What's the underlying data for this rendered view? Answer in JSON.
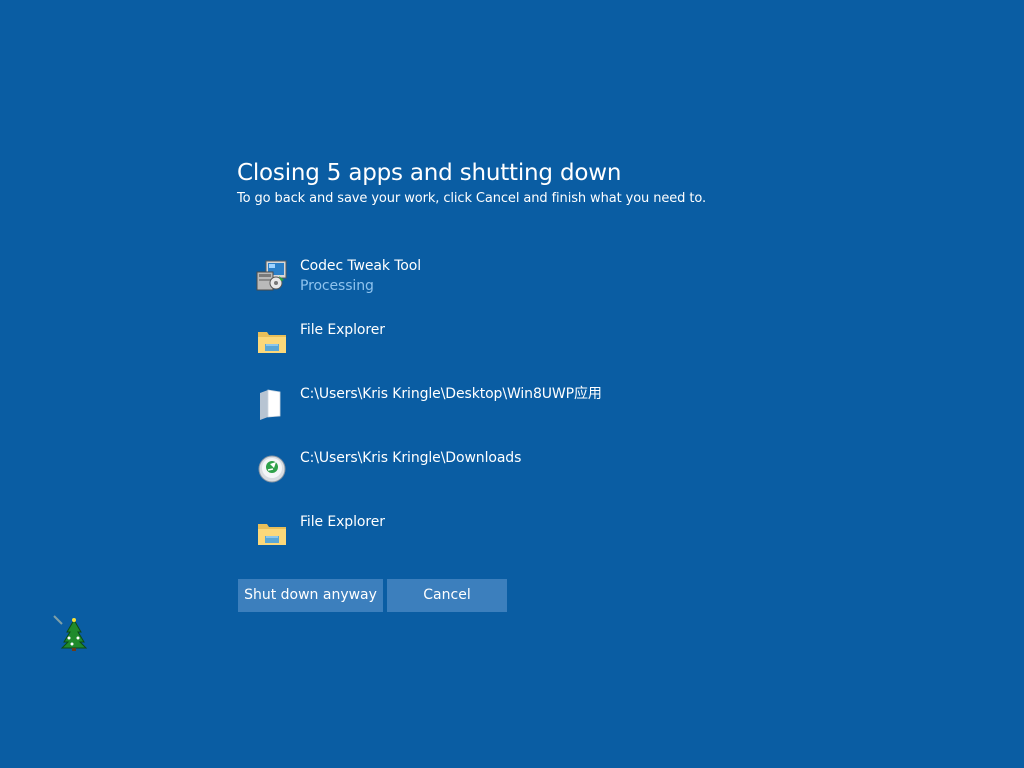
{
  "dialog": {
    "title": "Closing 5 apps and shutting down",
    "subtitle": "To go back and save your work, click Cancel and finish what you need to."
  },
  "apps": [
    {
      "name": "Codec Tweak Tool",
      "status": "Processing",
      "icon": "installer-icon"
    },
    {
      "name": "File Explorer",
      "status": "",
      "icon": "folder-icon"
    },
    {
      "name": "C:\\Users\\Kris Kringle\\Desktop\\Win8UWP应用",
      "status": "",
      "icon": "blank-folder-icon"
    },
    {
      "name": "C:\\Users\\Kris Kringle\\Downloads",
      "status": "",
      "icon": "green-disc-icon"
    },
    {
      "name": "File Explorer",
      "status": "",
      "icon": "folder-icon"
    }
  ],
  "buttons": {
    "shutdown_label": "Shut down anyway",
    "cancel_label": "Cancel"
  },
  "cursor": {
    "icon": "christmas-tree-cursor-icon"
  },
  "colors": {
    "background": "#0a5da3",
    "button": "#3c7fbd",
    "status_text": "#8fc3ee"
  }
}
